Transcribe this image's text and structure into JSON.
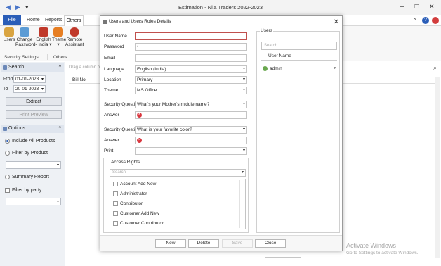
{
  "window": {
    "title": "Estimation - Nila Traders 2022-2023",
    "qa_back": "◀",
    "qa_forward": "▶",
    "qa_more": "▾",
    "minimize": "–",
    "restore": "❐",
    "close": "✕"
  },
  "ribbon_tabs": {
    "file": "File",
    "home": "Home",
    "reports": "Reports",
    "others": "Others",
    "collapse": "^",
    "help": "?"
  },
  "ribbon": {
    "buttons": [
      {
        "label_l1": "Users",
        "label_l2": "",
        "color": "#d9a441"
      },
      {
        "label_l1": "Change",
        "label_l2": "Password",
        "color": "#5b9bd5"
      },
      {
        "label_l1": "English",
        "label_l2": "- India ▾",
        "color": "#c0392b"
      },
      {
        "label_l1": "Theme",
        "label_l2": "▾",
        "color": "#e67e22"
      },
      {
        "label_l1": "Remote",
        "label_l2": "Assistant",
        "color": "#c0392b"
      }
    ],
    "groups": [
      "Security Settings",
      "Others"
    ]
  },
  "left_panel": {
    "search_header": "Search",
    "from_label": "From",
    "from_value": "01-01-2023",
    "to_label": "To",
    "to_value": "20-01-2023",
    "extract": "Extract",
    "print_preview": "Print Preview",
    "options_header": "Options",
    "include_all": "Include All Products",
    "filter_product": "Filter by Product",
    "summary_report": "Summary Report",
    "filter_party": "Filter by party"
  },
  "grid": {
    "group_hint": "Drag a column h",
    "col_bill_no": "Bill No",
    "watermark_title": "Activate Windows",
    "watermark_sub": "Go to Settings to activate Windows."
  },
  "dialog": {
    "title": "Users and Users Roles Details",
    "close": "✕",
    "fields": {
      "user_name_label": "User Name",
      "user_name_value": "",
      "password_label": "Password",
      "password_value": "•",
      "email_label": "Email",
      "email_value": "",
      "language_label": "Language",
      "language_value": "English (India)",
      "location_label": "Location",
      "location_value": "Primary",
      "theme_label": "Theme",
      "theme_value": "MS Office",
      "security_q1_label": "Security Question",
      "security_q1_value": "What's your Mother's middle name?",
      "answer1_label": "Answer",
      "security_q2_label": "Security Question",
      "security_q2_value": "What is your favorite color?",
      "answer2_label": "Answer",
      "print_label": "Print",
      "print_value": ""
    },
    "access_rights": {
      "title": "Access Rights",
      "search_placeholder": "Search",
      "items": [
        "Account Add New",
        "Administrator",
        "Contributor",
        "Customer Add New",
        "Customer Contributor"
      ]
    },
    "users": {
      "title": "Users",
      "search_placeholder": "Search",
      "column": "User Name",
      "rows": [
        "admin"
      ]
    },
    "buttons": {
      "new": "New",
      "delete": "Delete",
      "save": "Save",
      "close": "Close"
    }
  }
}
